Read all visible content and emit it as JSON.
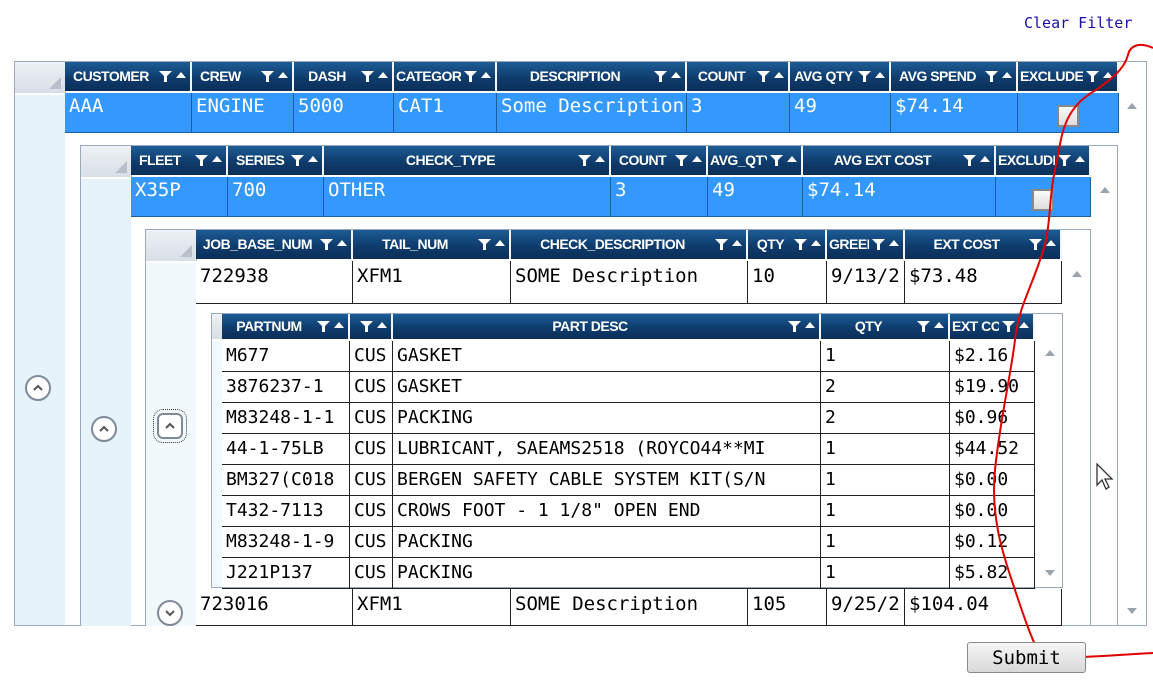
{
  "toolbar": {
    "clear_filter": "Clear Filter"
  },
  "level1": {
    "headers": [
      "CUSTOMER",
      "CREW",
      "DASH",
      "CATEGORY",
      "DESCRIPTION",
      "COUNT",
      "AVG QTY",
      "AVG SPEND",
      "EXCLUDE?"
    ],
    "row": [
      "AAA",
      "ENGINE",
      "5000",
      "CAT1",
      "Some Description",
      "3",
      "49",
      "$74.14"
    ],
    "excluded": false
  },
  "level2": {
    "headers": [
      "FLEET",
      "SERIES",
      "CHECK_TYPE",
      "COUNT",
      "AVG_QTY",
      "AVG EXT COST",
      "EXCLUDE"
    ],
    "row": [
      "X35P",
      "700",
      "OTHER",
      "3",
      "49",
      "$74.14"
    ],
    "excluded": false
  },
  "level3": {
    "headers": [
      "JOB_BASE_NUM",
      "TAIL_NUM",
      "CHECK_DESCRIPTION",
      "QTY",
      "GREEN",
      "EXT COST"
    ],
    "rows": [
      [
        "722938",
        "XFM1",
        "SOME Description",
        "10",
        "9/13/2",
        "$73.48"
      ],
      [
        "723016",
        "XFM1",
        "SOME Description",
        "105",
        "9/25/2",
        "$104.04"
      ]
    ]
  },
  "level4": {
    "headers": [
      "PARTNUM",
      "",
      "PART DESC",
      "QTY",
      "EXT COST"
    ],
    "rows": [
      [
        "M677",
        "CUS",
        "GASKET",
        "1",
        "$2.16"
      ],
      [
        "3876237-1",
        "CUS",
        "GASKET",
        "2",
        "$19.90"
      ],
      [
        "M83248-1-1",
        "CUS",
        "PACKING",
        "2",
        "$0.96"
      ],
      [
        "44-1-75LB",
        "CUS",
        "LUBRICANT, SAEAMS2518 (ROYCO44**MI",
        "1",
        "$44.52"
      ],
      [
        "BM327(C018",
        "CUS",
        "BERGEN SAFETY CABLE SYSTEM KIT(S/N",
        "1",
        "$0.00"
      ],
      [
        "T432-7113",
        "CUS",
        "CROWS FOOT - 1 1/8\" OPEN END",
        "1",
        "$0.00"
      ],
      [
        "M83248-1-9",
        "CUS",
        "PACKING",
        "1",
        "$0.12"
      ],
      [
        "J221P137",
        "CUS",
        "PACKING",
        "1",
        "$5.82"
      ]
    ]
  },
  "submit_label": "Submit",
  "colors": {
    "header": "#0f3c6d",
    "selected": "#3399ff",
    "annotation": "#e00000"
  }
}
